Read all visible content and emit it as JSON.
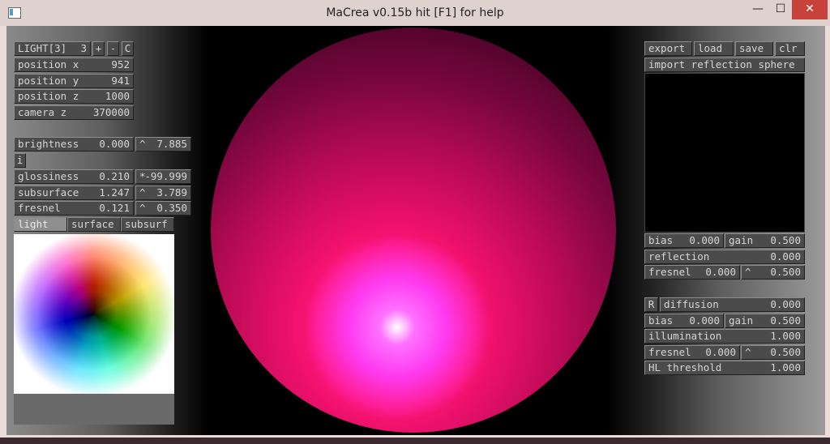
{
  "window": {
    "title": "MaCrea v0.15b   hit [F1] for help",
    "min_icon": "minimize-icon",
    "max_icon": "maximize-icon",
    "close_icon": "close-icon",
    "min_glyph": "—",
    "max_glyph": "☐",
    "close_glyph": "✕"
  },
  "left": {
    "light_selector": {
      "label": "LIGHT[3]",
      "value": "3",
      "plus": "+",
      "minus": "-",
      "clear": "C"
    },
    "position_x": {
      "label": "position x",
      "value": "952"
    },
    "position_y": {
      "label": "position y",
      "value": "941"
    },
    "position_z": {
      "label": "position z",
      "value": "1000"
    },
    "camera_z": {
      "label": "camera z",
      "value": "370000"
    },
    "brightness": {
      "label": "brightness",
      "value": "0.000",
      "exp_prefix": "^",
      "exp_value": "7.885"
    },
    "i_button": "i",
    "glossiness": {
      "label": "glossiness",
      "value": "0.210",
      "exp_prefix": "*",
      "exp_value": "-99.999"
    },
    "subsurface": {
      "label": "subsurface",
      "value": "1.247",
      "exp_prefix": "^",
      "exp_value": "3.789"
    },
    "fresnel": {
      "label": "fresnel",
      "value": "0.121",
      "exp_prefix": "^",
      "exp_value": "0.350"
    },
    "tabs": [
      "light",
      "surface",
      "subsurf"
    ],
    "selected_tab": "light"
  },
  "right": {
    "export": "export",
    "load": "load",
    "save": "save",
    "clr": "clr",
    "import": "import reflection sphere",
    "refl_bias": {
      "label": "bias",
      "value": "0.000"
    },
    "refl_gain": {
      "label": "gain",
      "value": "0.500"
    },
    "reflection": {
      "label": "reflection",
      "value": "0.000"
    },
    "refl_fresnel": {
      "label": "fresnel",
      "value": "0.000",
      "exp_prefix": "^",
      "exp_value": "0.500"
    },
    "r_button": "R",
    "diffusion": {
      "label": "diffusion",
      "value": "0.000"
    },
    "diff_bias": {
      "label": "bias",
      "value": "0.000"
    },
    "diff_gain": {
      "label": "gain",
      "value": "0.500"
    },
    "illumination": {
      "label": "illumination",
      "value": "1.000"
    },
    "diff_fresnel": {
      "label": "fresnel",
      "value": "0.000",
      "exp_prefix": "^",
      "exp_value": "0.500"
    },
    "hl_threshold": {
      "label": "HL threshold",
      "value": "1.000"
    }
  },
  "colors": {
    "control_bg": "#4b4b4b",
    "selected_tab_bg": "#8e8e8e",
    "sphere_core": "#ff1474",
    "highlight": "#ff70ff",
    "close_button": "#c8413a"
  }
}
